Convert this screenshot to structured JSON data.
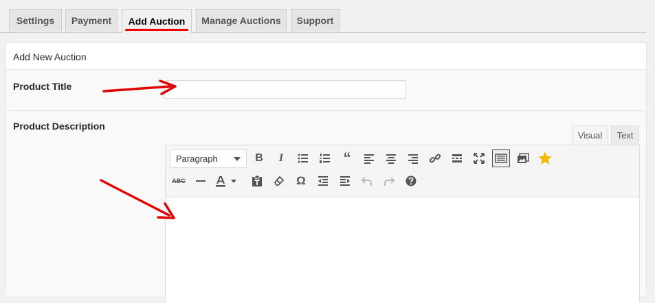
{
  "tabs": [
    {
      "label": "Settings"
    },
    {
      "label": "Payment"
    },
    {
      "label": "Add Auction"
    },
    {
      "label": "Manage Auctions"
    },
    {
      "label": "Support"
    }
  ],
  "panel": {
    "heading": "Add New Auction",
    "product_title_label": "Product Title",
    "product_title_value": "",
    "product_description_label": "Product Description"
  },
  "editor": {
    "visual_tab": "Visual",
    "text_tab": "Text",
    "format_select": "Paragraph"
  },
  "colors": {
    "annotation": "#e00000",
    "star": "#f5b800"
  }
}
